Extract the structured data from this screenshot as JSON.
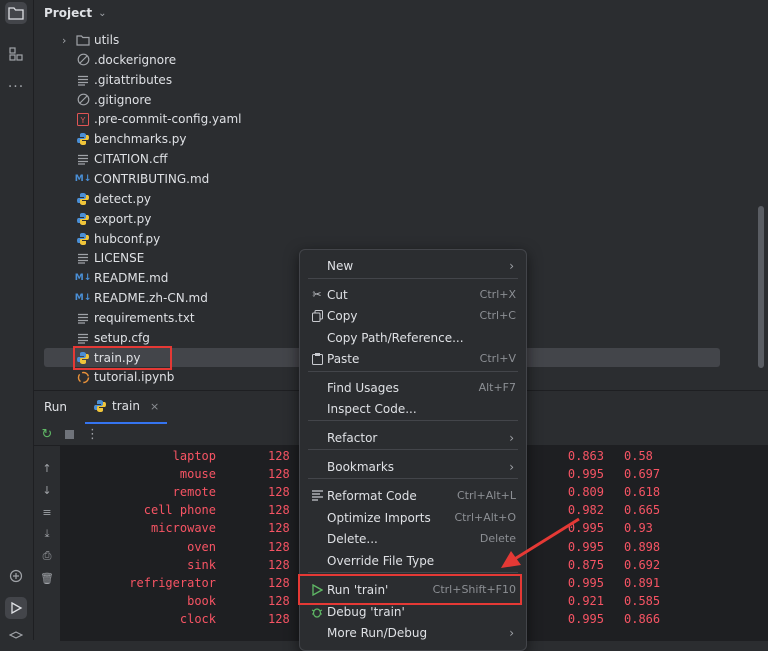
{
  "project": {
    "title": "Project",
    "items": [
      {
        "label": "utils",
        "icon": "folder-icon",
        "kind": "folder"
      },
      {
        "label": ".dockerignore",
        "icon": "ignore-file-icon"
      },
      {
        "label": ".gitattributes",
        "icon": "text-file-icon"
      },
      {
        "label": ".gitignore",
        "icon": "ignore-file-icon"
      },
      {
        "label": ".pre-commit-config.yaml",
        "icon": "yaml-file-icon"
      },
      {
        "label": "benchmarks.py",
        "icon": "python-file-icon"
      },
      {
        "label": "CITATION.cff",
        "icon": "text-file-icon"
      },
      {
        "label": "CONTRIBUTING.md",
        "icon": "markdown-file-icon"
      },
      {
        "label": "detect.py",
        "icon": "python-file-icon"
      },
      {
        "label": "export.py",
        "icon": "python-file-icon"
      },
      {
        "label": "hubconf.py",
        "icon": "python-file-icon"
      },
      {
        "label": "LICENSE",
        "icon": "text-file-icon"
      },
      {
        "label": "README.md",
        "icon": "markdown-file-icon"
      },
      {
        "label": "README.zh-CN.md",
        "icon": "markdown-file-icon"
      },
      {
        "label": "requirements.txt",
        "icon": "text-file-icon"
      },
      {
        "label": "setup.cfg",
        "icon": "text-file-icon"
      },
      {
        "label": "train.py",
        "icon": "python-file-icon",
        "selected": true
      },
      {
        "label": "tutorial.ipynb",
        "icon": "notebook-file-icon"
      }
    ]
  },
  "run": {
    "title": "Run",
    "tab_label": "train",
    "tab_close": "×",
    "rows": [
      {
        "cls": "laptop",
        "n": "128",
        "a": "0.863",
        "b": "0.58"
      },
      {
        "cls": "mouse",
        "n": "128",
        "a": "0.995",
        "b": "0.697"
      },
      {
        "cls": "remote",
        "n": "128",
        "a": "0.809",
        "b": "0.618"
      },
      {
        "cls": "cell phone",
        "n": "128",
        "a": "0.982",
        "b": "0.665"
      },
      {
        "cls": "microwave",
        "n": "128",
        "a": "0.995",
        "b": "0.93"
      },
      {
        "cls": "oven",
        "n": "128",
        "a": "0.995",
        "b": "0.898"
      },
      {
        "cls": "sink",
        "n": "128",
        "a": "0.875",
        "b": "0.692"
      },
      {
        "cls": "refrigerator",
        "n": "128",
        "a": "0.995",
        "b": "0.891"
      },
      {
        "cls": "book",
        "n": "128",
        "a": "0.921",
        "b": "0.585"
      },
      {
        "cls": "clock",
        "n": "128",
        "a": "0.995",
        "b": "0.866"
      }
    ]
  },
  "menu": {
    "items": [
      {
        "label": "New",
        "shortcut": "",
        "submenu": true,
        "icon": ""
      },
      {
        "sep": true
      },
      {
        "label": "Cut",
        "shortcut": "Ctrl+X",
        "icon": "scissors-icon"
      },
      {
        "label": "Copy",
        "shortcut": "Ctrl+C",
        "icon": "copy-icon"
      },
      {
        "label": "Copy Path/Reference...",
        "shortcut": "",
        "icon": ""
      },
      {
        "label": "Paste",
        "shortcut": "Ctrl+V",
        "icon": "paste-icon"
      },
      {
        "sep": true
      },
      {
        "label": "Find Usages",
        "shortcut": "Alt+F7",
        "icon": ""
      },
      {
        "label": "Inspect Code...",
        "shortcut": "",
        "icon": ""
      },
      {
        "sep": true
      },
      {
        "label": "Refactor",
        "shortcut": "",
        "submenu": true,
        "icon": ""
      },
      {
        "sep": true
      },
      {
        "label": "Bookmarks",
        "shortcut": "",
        "submenu": true,
        "icon": ""
      },
      {
        "sep": true
      },
      {
        "label": "Reformat Code",
        "shortcut": "Ctrl+Alt+L",
        "icon": "reformat-icon"
      },
      {
        "label": "Optimize Imports",
        "shortcut": "Ctrl+Alt+O",
        "icon": ""
      },
      {
        "label": "Delete...",
        "shortcut": "Delete",
        "icon": ""
      },
      {
        "label": "Override File Type",
        "shortcut": "",
        "icon": ""
      },
      {
        "sep": true
      },
      {
        "label": "Run 'train'",
        "shortcut": "Ctrl+Shift+F10",
        "icon": "run-icon",
        "highlight": true
      },
      {
        "label": "Debug 'train'",
        "shortcut": "",
        "icon": "debug-icon"
      },
      {
        "label": "More Run/Debug",
        "shortcut": "",
        "submenu": true,
        "icon": ""
      }
    ]
  },
  "colors": {
    "accent": "#3574f0",
    "highlight_red": "#e53935",
    "console_text": "#f75464",
    "python_blue": "#4a8fd6",
    "python_yellow": "#f0c53a"
  }
}
